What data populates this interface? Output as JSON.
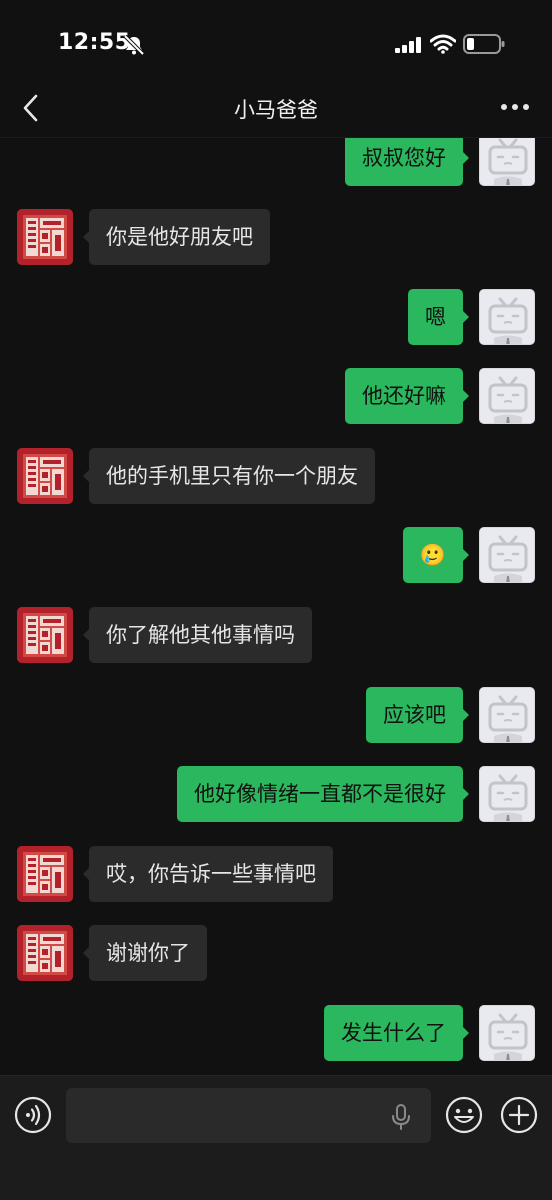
{
  "status_bar": {
    "time": "12:55"
  },
  "nav": {
    "title": "小马爸爸"
  },
  "messages": [
    {
      "from": "me",
      "text": "叔叔您好"
    },
    {
      "from": "them",
      "text": "你是他好朋友吧"
    },
    {
      "from": "me",
      "text": "嗯"
    },
    {
      "from": "me",
      "text": "他还好嘛"
    },
    {
      "from": "them",
      "text": "他的手机里只有你一个朋友"
    },
    {
      "from": "me",
      "text": "🥲"
    },
    {
      "from": "them",
      "text": "你了解他其他事情吗"
    },
    {
      "from": "me",
      "text": "应该吧"
    },
    {
      "from": "me",
      "text": "他好像情绪一直都不是很好"
    },
    {
      "from": "them",
      "text": "哎，你告诉一些事情吧"
    },
    {
      "from": "them",
      "text": "谢谢你了"
    },
    {
      "from": "me",
      "text": "发生什么了"
    }
  ],
  "input": {
    "value": ""
  },
  "colors": {
    "background": "#111111",
    "my_bubble": "#2bb75d",
    "their_bubble": "#2b2b2b",
    "input_bar": "#1c1c1c"
  },
  "icons": {
    "back": "chevron-left-icon",
    "more": "more-dots-icon",
    "voice": "voice-icon",
    "mic": "mic-icon",
    "emoji": "emoji-icon",
    "plus": "plus-icon",
    "bell": "bell-muted-icon",
    "signal": "signal-icon",
    "wifi": "wifi-icon",
    "battery": "battery-icon"
  }
}
